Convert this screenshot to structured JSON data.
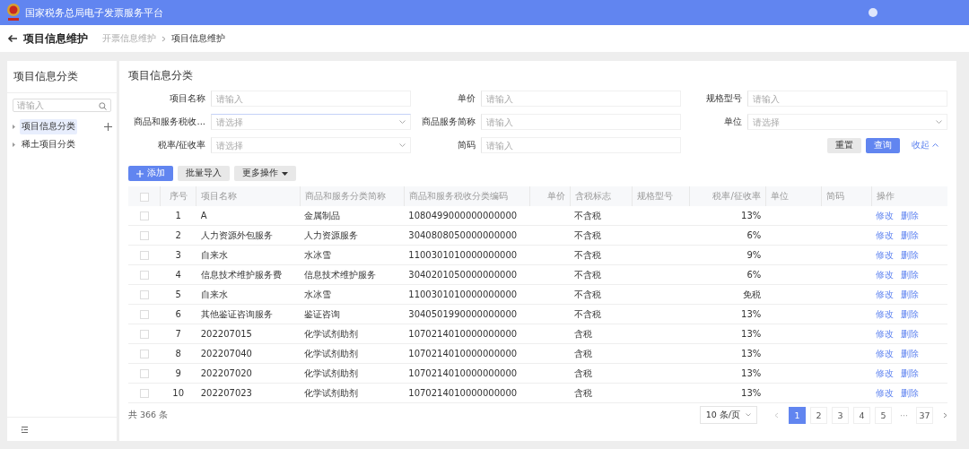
{
  "header": {
    "title": "国家税务总局电子发票服务平台"
  },
  "page": {
    "title": "项目信息维护",
    "breadcrumb": [
      {
        "label": "开票信息维护"
      },
      {
        "label": "项目信息维护"
      }
    ]
  },
  "sidebar": {
    "title": "项目信息分类",
    "search": {
      "placeholder": "请输入"
    },
    "tree": [
      {
        "label": "项目信息分类",
        "selected": true,
        "expanded": false
      },
      {
        "label": "稀土项目分类",
        "selected": false,
        "expanded": false
      }
    ]
  },
  "form": {
    "title": "项目信息分类",
    "fields": [
      {
        "label": "项目名称",
        "kind": "input",
        "placeholder": "请输入",
        "focused": false
      },
      {
        "label": "单价",
        "kind": "input",
        "placeholder": "请输入",
        "focused": false
      },
      {
        "label": "规格型号",
        "kind": "input",
        "placeholder": "请输入",
        "focused": false
      },
      {
        "label": "商品和服务税收...",
        "kind": "select",
        "placeholder": "请选择",
        "focused": true
      },
      {
        "label": "商品服务简称",
        "kind": "input",
        "placeholder": "请输入",
        "focused": false
      },
      {
        "label": "单位",
        "kind": "select",
        "placeholder": "请选择",
        "focused": false
      },
      {
        "label": "税率/征收率",
        "kind": "select",
        "placeholder": "请选择",
        "focused": false
      },
      {
        "label": "简码",
        "kind": "input",
        "placeholder": "请输入",
        "focused": false
      }
    ],
    "buttons": [
      {
        "label": "重置",
        "kind": "default"
      },
      {
        "label": "查询",
        "kind": "primary"
      }
    ],
    "collapse": "收起"
  },
  "toolbar": [
    {
      "label": "添加",
      "kind": "primary"
    },
    {
      "label": "批量导入",
      "kind": "default"
    },
    {
      "label": "更多操作",
      "kind": "dropdown"
    }
  ],
  "table": {
    "select_all": false,
    "columns": [
      "序号",
      "项目名称",
      "商品和服务分类简称",
      "商品和服务税收分类编码",
      "单价",
      "含税标志",
      "规格型号",
      "税率/征收率",
      "单位",
      "简码",
      "操作"
    ],
    "rows": [
      {
        "checked": false,
        "cells": [
          "1",
          "A",
          "金属制品",
          "1080499000000000000",
          "",
          "不含税",
          "",
          "13%",
          "",
          ""
        ],
        "actions": [
          "修改",
          "删除"
        ]
      },
      {
        "checked": false,
        "cells": [
          "2",
          "人力资源外包服务",
          "人力资源服务",
          "3040808050000000000",
          "",
          "不含税",
          "",
          "6%",
          "",
          ""
        ],
        "actions": [
          "修改",
          "删除"
        ]
      },
      {
        "checked": false,
        "cells": [
          "3",
          "自来水",
          "水冰雪",
          "1100301010000000000",
          "",
          "不含税",
          "",
          "9%",
          "",
          ""
        ],
        "actions": [
          "修改",
          "删除"
        ]
      },
      {
        "checked": false,
        "cells": [
          "4",
          "信息技术维护服务费",
          "信息技术维护服务",
          "3040201050000000000",
          "",
          "不含税",
          "",
          "6%",
          "",
          ""
        ],
        "actions": [
          "修改",
          "删除"
        ]
      },
      {
        "checked": false,
        "cells": [
          "5",
          "自来水",
          "水冰雪",
          "1100301010000000000",
          "",
          "不含税",
          "",
          "免税",
          "",
          ""
        ],
        "actions": [
          "修改",
          "删除"
        ]
      },
      {
        "checked": false,
        "cells": [
          "6",
          "其他鉴证咨询服务",
          "鉴证咨询",
          "3040501990000000000",
          "",
          "不含税",
          "",
          "13%",
          "",
          ""
        ],
        "actions": [
          "修改",
          "删除"
        ]
      },
      {
        "checked": false,
        "cells": [
          "7",
          "202207015",
          "化学试剂助剂",
          "1070214010000000000",
          "",
          "含税",
          "",
          "13%",
          "",
          ""
        ],
        "actions": [
          "修改",
          "删除"
        ]
      },
      {
        "checked": false,
        "cells": [
          "8",
          "202207040",
          "化学试剂助剂",
          "1070214010000000000",
          "",
          "含税",
          "",
          "13%",
          "",
          ""
        ],
        "actions": [
          "修改",
          "删除"
        ]
      },
      {
        "checked": false,
        "cells": [
          "9",
          "202207020",
          "化学试剂助剂",
          "1070214010000000000",
          "",
          "含税",
          "",
          "13%",
          "",
          ""
        ],
        "actions": [
          "修改",
          "删除"
        ]
      },
      {
        "checked": false,
        "cells": [
          "10",
          "202207023",
          "化学试剂助剂",
          "1070214010000000000",
          "",
          "含税",
          "",
          "13%",
          "",
          ""
        ],
        "actions": [
          "修改",
          "删除"
        ]
      }
    ]
  },
  "pager": {
    "total": "共 366 条",
    "page_size": "10 条/页",
    "pages": [
      {
        "label": "1",
        "kind": "page",
        "selected": true
      },
      {
        "label": "2",
        "kind": "page",
        "selected": false
      },
      {
        "label": "3",
        "kind": "page",
        "selected": false
      },
      {
        "label": "4",
        "kind": "page",
        "selected": false
      },
      {
        "label": "5",
        "kind": "page",
        "selected": false
      },
      {
        "label": "···",
        "kind": "ellipsis",
        "selected": false
      },
      {
        "label": "37",
        "kind": "page",
        "selected": false
      }
    ]
  }
}
